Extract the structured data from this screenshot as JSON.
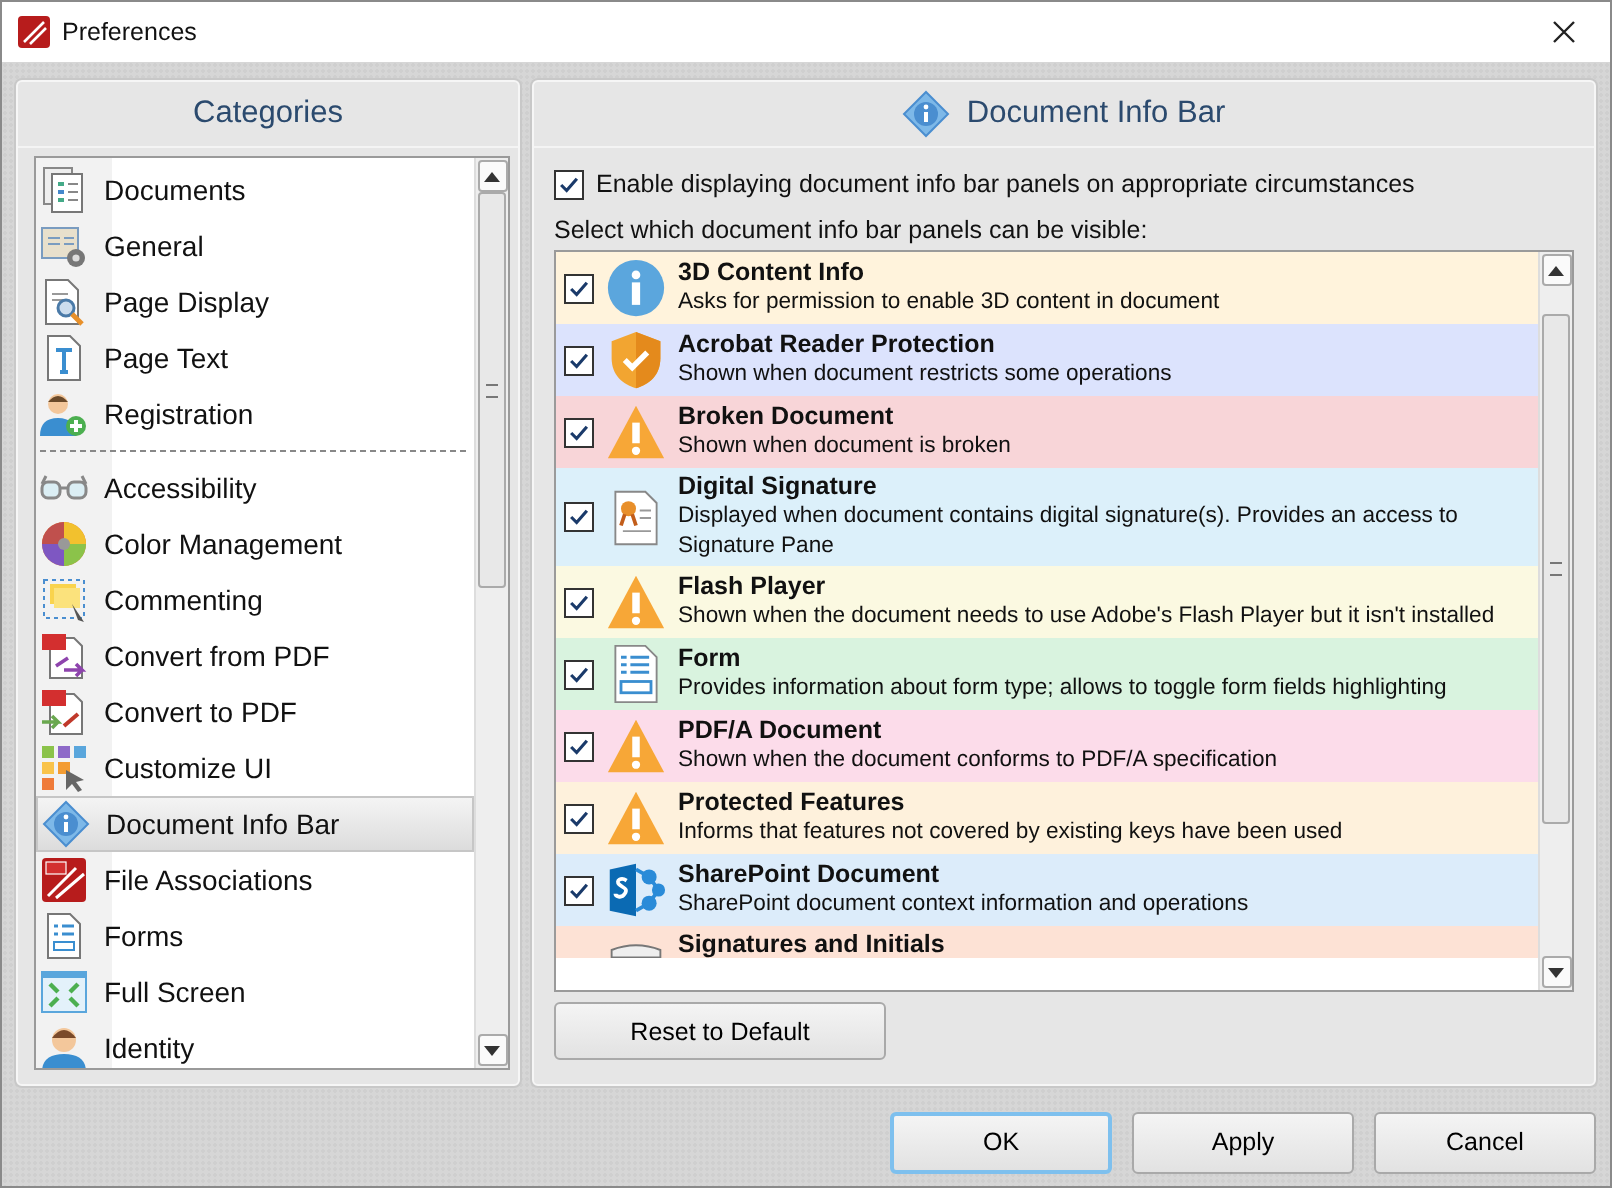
{
  "window": {
    "title": "Preferences"
  },
  "categories": {
    "title": "Categories",
    "groups": [
      [
        {
          "label": "Documents",
          "selected": false
        },
        {
          "label": "General",
          "selected": false
        },
        {
          "label": "Page Display",
          "selected": false
        },
        {
          "label": "Page Text",
          "selected": false
        },
        {
          "label": "Registration",
          "selected": false
        }
      ],
      [
        {
          "label": "Accessibility",
          "selected": false
        },
        {
          "label": "Color Management",
          "selected": false
        },
        {
          "label": "Commenting",
          "selected": false
        },
        {
          "label": "Convert from PDF",
          "selected": false
        },
        {
          "label": "Convert to PDF",
          "selected": false
        },
        {
          "label": "Customize UI",
          "selected": false
        },
        {
          "label": "Document Info Bar",
          "selected": true
        },
        {
          "label": "File Associations",
          "selected": false
        },
        {
          "label": "Forms",
          "selected": false
        },
        {
          "label": "Full Screen",
          "selected": false
        },
        {
          "label": "Identity",
          "selected": false
        }
      ]
    ]
  },
  "panel": {
    "title": "Document Info Bar",
    "enable": {
      "label": "Enable displaying document info bar panels on appropriate circumstances",
      "checked": true
    },
    "list_label": "Select which document info bar panels can be visible:",
    "items": [
      {
        "title": "3D Content Info",
        "description": "Asks for permission to enable 3D content in document",
        "kind": "info",
        "color": "#fff3dc",
        "checked": true
      },
      {
        "title": "Acrobat Reader Protection",
        "description": "Shown when document restricts some operations",
        "kind": "shield",
        "color": "#dce3fd",
        "checked": true
      },
      {
        "title": "Broken Document",
        "description": "Shown when document is broken",
        "kind": "warning",
        "color": "#f8d5d8",
        "checked": true
      },
      {
        "title": "Digital Signature",
        "description": "Displayed when document contains digital signature(s). Provides an access to Signature Pane",
        "kind": "certificate",
        "color": "#dcf0fa",
        "checked": true
      },
      {
        "title": "Flash Player",
        "description": "Shown when the document needs to use Adobe's Flash Player but it isn't installed",
        "kind": "warning",
        "color": "#fbf9e1",
        "checked": true
      },
      {
        "title": "Form",
        "description": "Provides information about form type; allows to toggle form fields highlighting",
        "kind": "form",
        "color": "#d9f3df",
        "checked": true
      },
      {
        "title": "PDF/A Document",
        "description": "Shown when the document conforms to PDF/A specification",
        "kind": "warning",
        "color": "#fcdcea",
        "checked": true
      },
      {
        "title": "Protected Features",
        "description": "Informs that features not covered by existing keys have been used",
        "kind": "warning",
        "color": "#fef1dc",
        "checked": true
      },
      {
        "title": "SharePoint Document",
        "description": "SharePoint document context information and operations",
        "kind": "sharepoint",
        "color": "#dcecfa",
        "checked": true
      },
      {
        "title": "Signatures and Initials",
        "kind": "partial",
        "color": "#fde2d5"
      }
    ],
    "reset_button": "Reset to Default"
  },
  "buttons": [
    {
      "label": "OK",
      "kind": "default"
    },
    {
      "label": "Apply",
      "kind": "normal"
    },
    {
      "label": "Cancel",
      "kind": "normal"
    }
  ]
}
